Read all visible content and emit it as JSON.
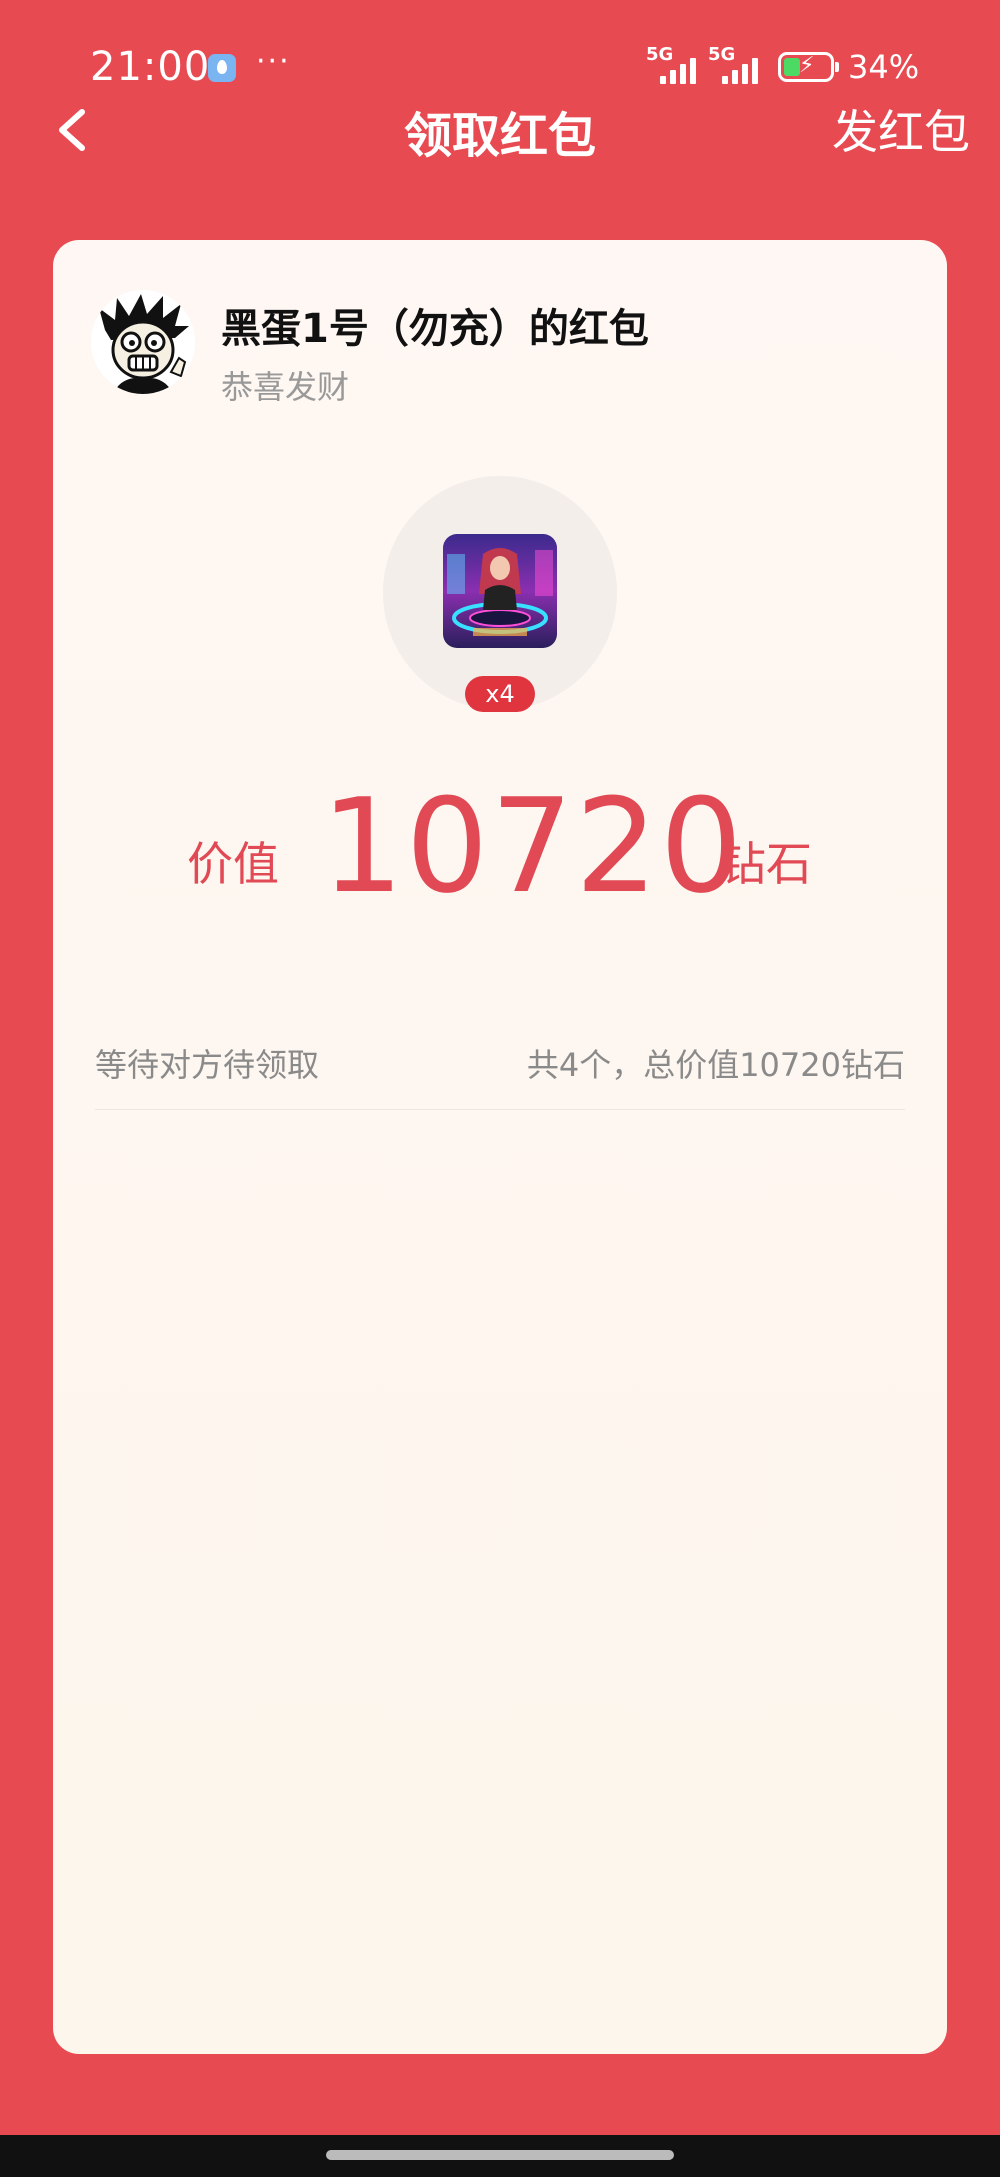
{
  "status_bar": {
    "time": "21:00",
    "more": "···",
    "network1": "5G",
    "network2": "5G",
    "battery_percent": "34%",
    "battery_level": 0.34
  },
  "nav": {
    "title": "领取红包",
    "right_action": "发红包"
  },
  "packet": {
    "sender_name": "黑蛋1号（勿充）的红包",
    "blessing": "恭喜发财",
    "gift_count": "x4",
    "value_prefix": "价值",
    "value_number": "10720",
    "value_unit": "钻石",
    "status_text": "等待对方待领取",
    "summary_text": "共4个，总价值10720钻石"
  },
  "colors": {
    "background": "#e84a52",
    "accent": "#e14a55",
    "card": "#fdf6ec"
  }
}
